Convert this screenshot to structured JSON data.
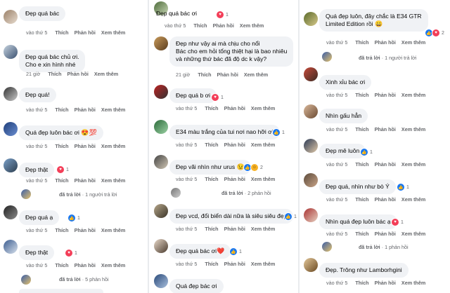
{
  "ui": {
    "time": "vào thứ 5",
    "like": "Thích",
    "reply": "Phản hồi",
    "more": "Xem thêm"
  },
  "col1": [
    {
      "text": "Đẹp quá bác",
      "time": "vào thứ 5"
    },
    {
      "text": "Đẹp quá bác chủ ơi.",
      "text2": "Cho e xin hình nhé",
      "time": "21 giờ"
    },
    {
      "text": "Đẹp quá!",
      "time": "vào thứ 5"
    },
    {
      "text": "Quá đẹp luôn bác ơi",
      "emoji": "😍💯",
      "time": "vào thứ 5"
    },
    {
      "text": "Đẹp thật",
      "time": "vào thứ 5",
      "reaction_count": "1"
    },
    {
      "text": "Đẹp quá ạ",
      "time": "vào thứ 5",
      "reaction_count": "1"
    },
    {
      "text": "Đẹp thật",
      "time": "vào thứ 5",
      "reaction_count": "1"
    }
  ],
  "col1_replies": [
    {
      "label": "đã trả lời",
      "count": "· 1 người trả lời"
    },
    {
      "label": "đã trả lời",
      "count": "· 5 phản hồi"
    }
  ],
  "col2": [
    {
      "text": "Đẹp quá bác ơi",
      "time": "vào thứ 5",
      "reaction_count": "1"
    },
    {
      "text": "Đẹp như vậy ai mà chịu cho nổi",
      "text2": "Bác cho em hỏi tổng thiệt hại là bao nhiêu",
      "text3": "và những thứ bác đã độ dc k vậy?",
      "time": "21 giờ"
    },
    {
      "text": "Đẹp quá b ơi",
      "time": "vào thứ 5",
      "reaction_count": "1"
    },
    {
      "text": "E34 màu trắng của tui nơi nao hỡi ơi",
      "time": "vào thứ 5",
      "reaction_count": "1"
    },
    {
      "text": "Đẹp vãi nhìn như urus",
      "emoji": "😉",
      "time": "vào thứ 5",
      "reaction_count": "2"
    },
    {
      "text": "Đẹp vcd, đổi biển dài nữa là siêu siêu đẹp",
      "time": "vào thứ 5",
      "reaction_count": "1"
    },
    {
      "text": "Đẹp quá bác ơi",
      "emoji": "❤️",
      "time": "vào thứ 5",
      "reaction_count": "1"
    },
    {
      "text": "Quá đẹp bác ơi"
    }
  ],
  "col2_replies": [
    {
      "label": "đã trả lời",
      "count": "· 2 phản hồi"
    }
  ],
  "col3": [
    {
      "text": "Quá đẹp luôn, đây chắc là E34 GTR",
      "text2": "Limited Edition rồi",
      "emoji": "😀",
      "time": "vào thứ 5",
      "reaction_count": "2"
    },
    {
      "text": "Xinh xỉu bác ơi",
      "time": "vào thứ 5"
    },
    {
      "text": "Nhìn gấu hẳn",
      "time": "vào thứ 5",
      "emoji": "😊"
    },
    {
      "text": "Đẹp mê luôn",
      "time": "vào thứ 5",
      "reaction_count": "1"
    },
    {
      "text": "Đẹp quá, nhìn như bò Ý",
      "time": "vào thứ 5",
      "reaction_count": "1"
    },
    {
      "text": "Nhìn quá đẹp luôn bác ạ",
      "time": "vào thứ 5",
      "reaction_count": "1"
    },
    {
      "text": "Đẹp. Trông như Lamborhgini",
      "time": "vào thứ 5"
    }
  ],
  "col3_replies": [
    {
      "label": "đã trả lời",
      "count": "· 1 người trả lời"
    },
    {
      "label": "đã trả lời",
      "count": "· 1 phản hồi"
    }
  ],
  "colors": {
    "bubble": "#f0f2f5",
    "meta": "#65676b",
    "like": "#1877f2",
    "love": "#f33e58"
  }
}
